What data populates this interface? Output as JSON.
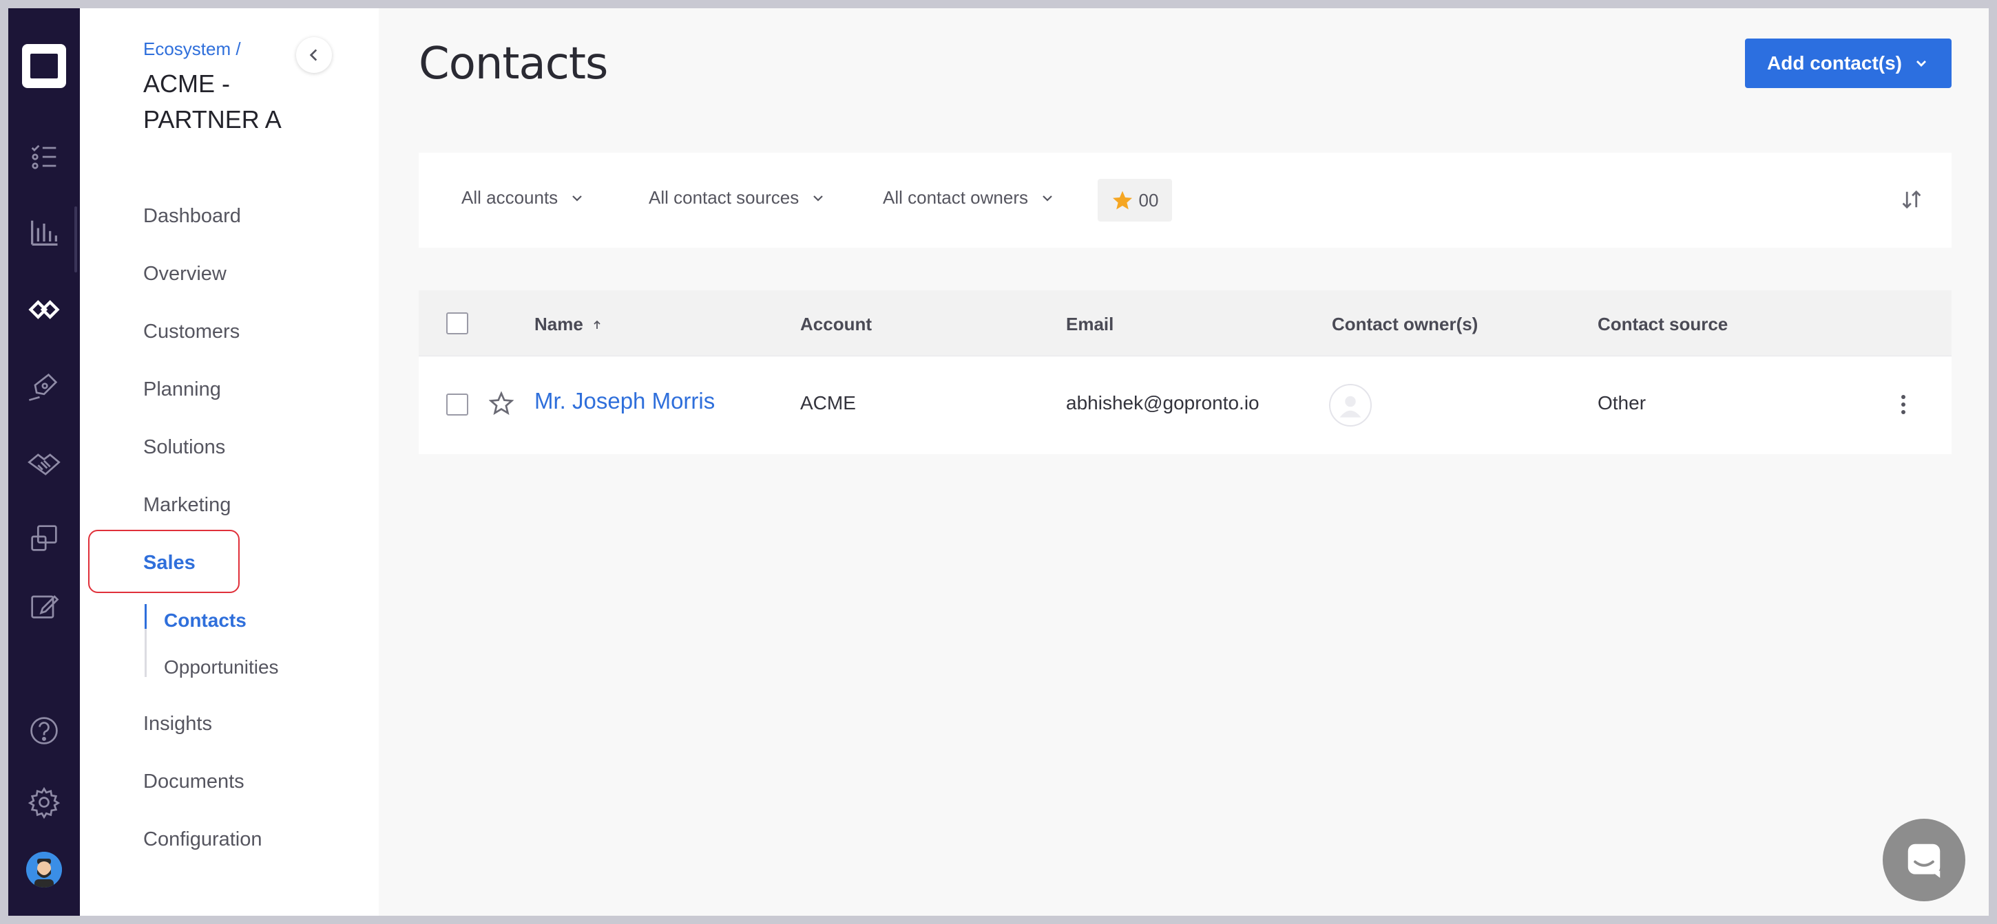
{
  "rail": {
    "icons": [
      "app-logo-icon",
      "tasks-icon",
      "bar-chart-icon",
      "ecosystem-icon",
      "pen-icon",
      "handshake-icon",
      "windows-icon",
      "edit-icon",
      "help-icon",
      "gear-icon",
      "user-avatar-icon"
    ]
  },
  "sidebar": {
    "breadcrumb": "Ecosystem /",
    "title": "ACME - PARTNER A",
    "items": {
      "dashboard": "Dashboard",
      "overview": "Overview",
      "customers": "Customers",
      "planning": "Planning",
      "solutions": "Solutions",
      "marketing": "Marketing",
      "sales": "Sales",
      "insights": "Insights",
      "documents": "Documents",
      "configuration": "Configuration"
    },
    "sales_sub": {
      "contacts": "Contacts",
      "opportunities": "Opportunities"
    }
  },
  "header": {
    "title": "Contacts",
    "add_button": "Add contact(s)"
  },
  "filters": {
    "accounts": "All accounts",
    "sources": "All contact sources",
    "owners": "All contact owners",
    "starred_count": "00"
  },
  "table": {
    "columns": {
      "name": "Name",
      "account": "Account",
      "email": "Email",
      "owners": "Contact owner(s)",
      "source": "Contact source"
    },
    "rows": [
      {
        "name": "Mr. Joseph Morris",
        "account": "ACME",
        "email": "abhishek@gopronto.io",
        "source": "Other"
      }
    ]
  },
  "colors": {
    "rail_bg": "#1c1537",
    "accent": "#2c6fe0",
    "highlight_box": "#e0303a",
    "star": "#f5a623"
  }
}
